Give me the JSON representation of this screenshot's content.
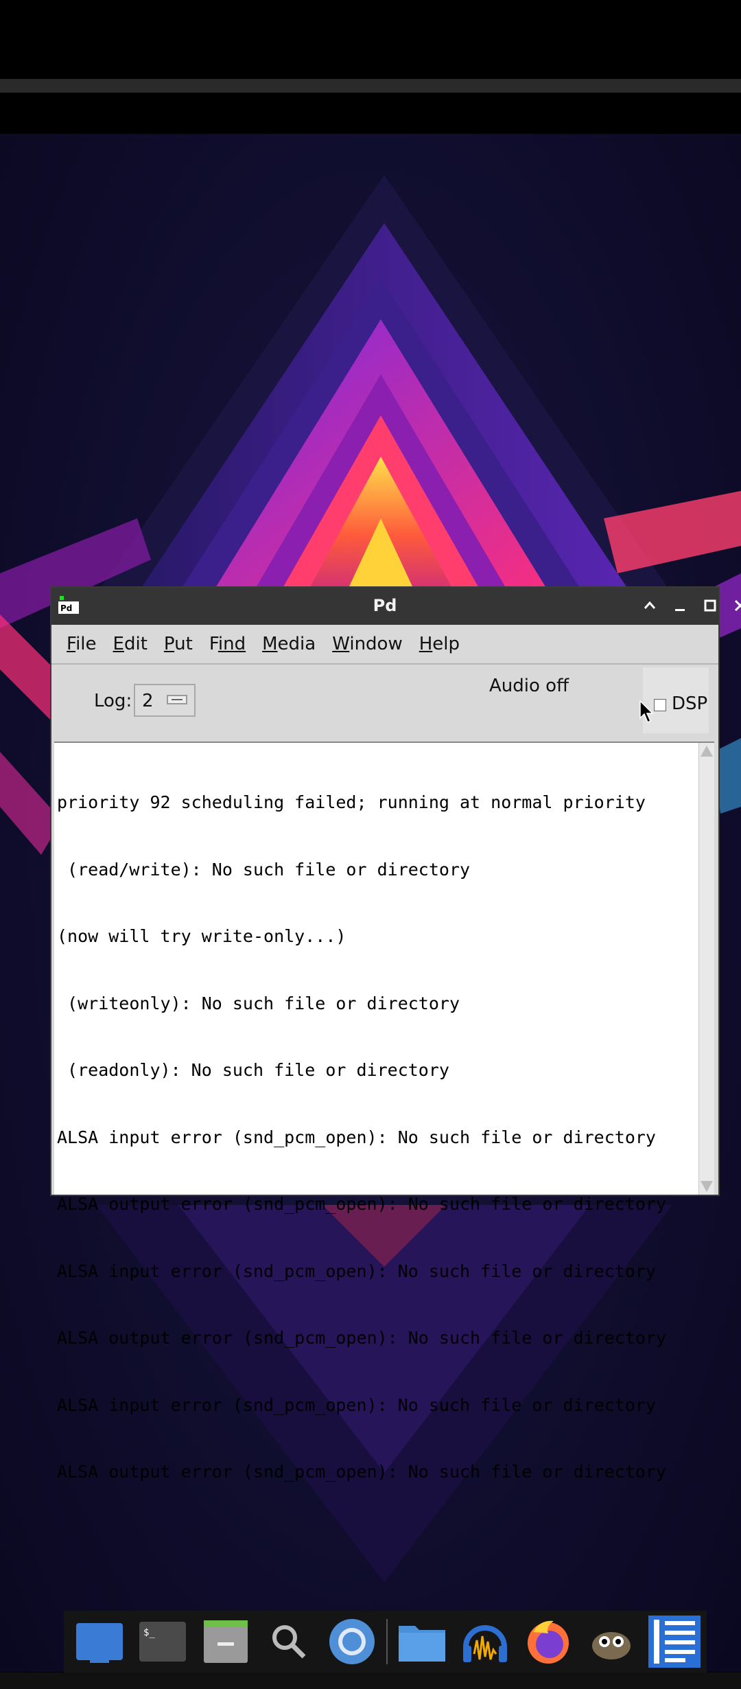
{
  "window": {
    "title": "Pd"
  },
  "menubar": {
    "items": [
      {
        "first": "F",
        "rest": "ile"
      },
      {
        "first": "E",
        "rest": "dit"
      },
      {
        "first": "P",
        "rest": "ut"
      },
      {
        "first": "F",
        "rest": "ind"
      },
      {
        "first": "M",
        "rest": "edia"
      },
      {
        "first": "W",
        "rest": "indow"
      },
      {
        "first": "H",
        "rest": "elp"
      }
    ]
  },
  "toolbar": {
    "log_label": "Log:",
    "log_value": "2",
    "audio_status": "Audio off",
    "dsp_label": "DSP",
    "dsp_checked": false
  },
  "console": {
    "lines": [
      "priority 92 scheduling failed; running at normal priority",
      " (read/write): No such file or directory",
      "(now will try write-only...)",
      " (writeonly): No such file or directory",
      " (readonly): No such file or directory",
      "ALSA input error (snd_pcm_open): No such file or directory",
      "ALSA output error (snd_pcm_open): No such file or directory",
      "ALSA input error (snd_pcm_open): No such file or directory",
      "ALSA output error (snd_pcm_open): No such file or directory",
      "ALSA input error (snd_pcm_open): No such file or directory",
      "ALSA output error (snd_pcm_open): No such file or directory"
    ]
  },
  "dock": {
    "items": [
      {
        "name": "show-desktop-icon",
        "color": "#3a7bd5"
      },
      {
        "name": "terminal-icon",
        "color": "#4a4a4a"
      },
      {
        "name": "file-archive-icon",
        "color": "#9a9a9a"
      },
      {
        "name": "search-icon",
        "color": "#bbbbbb"
      },
      {
        "name": "chromium-icon",
        "color": "#4f8fd8"
      },
      {
        "name": "file-manager-icon",
        "color": "#4a90d9"
      },
      {
        "name": "audacity-icon",
        "color": "#2d6fd0"
      },
      {
        "name": "firefox-icon",
        "color": "#ff7139"
      },
      {
        "name": "gimp-icon",
        "color": "#7a6a50"
      },
      {
        "name": "text-editor-icon",
        "color": "#2a6fd6"
      }
    ]
  }
}
